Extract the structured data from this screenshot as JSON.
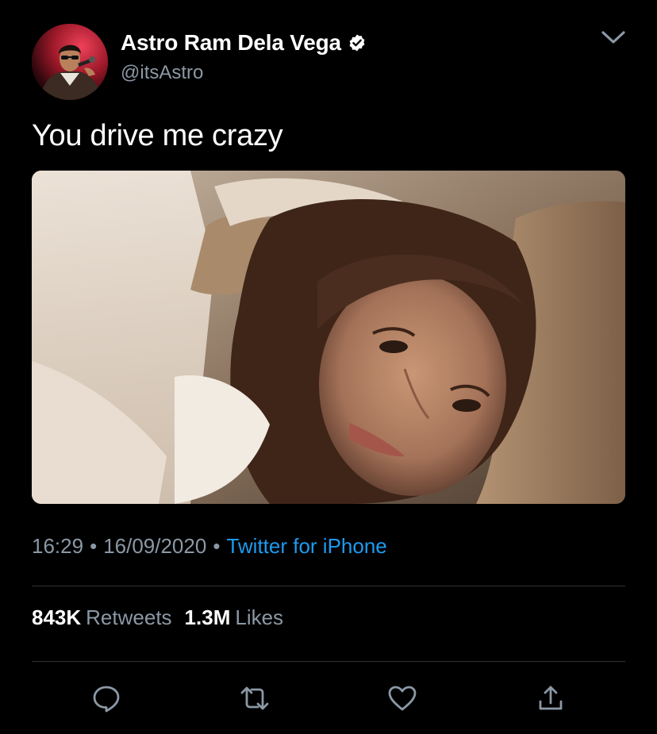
{
  "tweet": {
    "author": {
      "display_name": "Astro Ram Dela Vega",
      "handle": "@itsAstro",
      "verified": true
    },
    "text": "You drive me crazy",
    "meta": {
      "time": "16:29",
      "separator": "•",
      "date": "16/09/2020",
      "source": "Twitter for iPhone"
    },
    "stats": {
      "retweets_count": "843K",
      "retweets_label": "Retweets",
      "likes_count": "1.3M",
      "likes_label": "Likes"
    },
    "actions": [
      "reply-icon",
      "retweet-icon",
      "like-icon",
      "share-icon"
    ],
    "icons": {
      "verified": "verified-badge-icon",
      "menu": "chevron-down-icon"
    }
  },
  "colors": {
    "background": "#000000",
    "primary_text": "#ffffff",
    "secondary_text": "#8b98a5",
    "link": "#1d9bf0",
    "divider": "#2f3336"
  }
}
